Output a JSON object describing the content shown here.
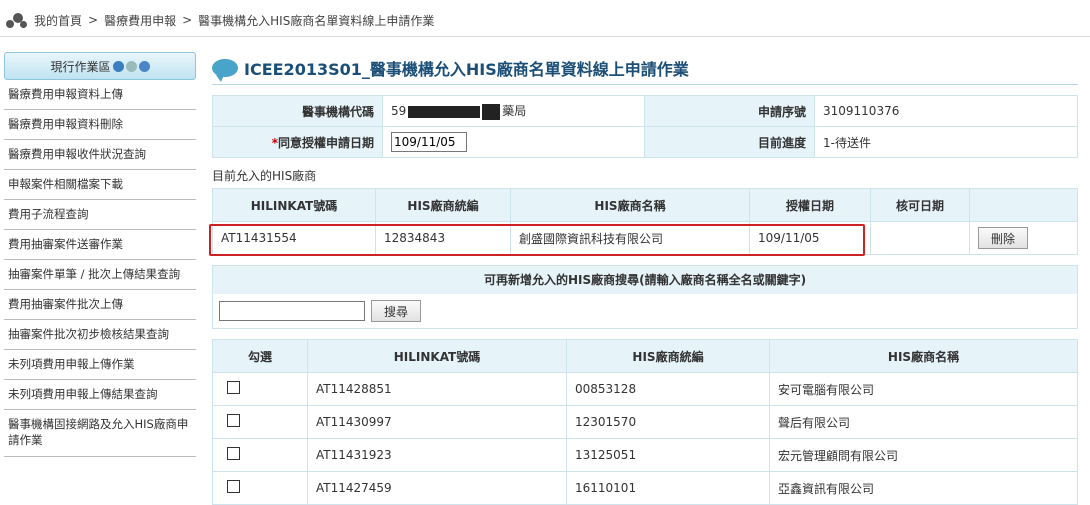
{
  "breadcrumb": {
    "home": "我的首頁",
    "sep": ">",
    "level1": "醫療費用申報",
    "level2": "醫事機構允入HIS廠商名單資料線上申請作業"
  },
  "sidebar": {
    "header": "現行作業區",
    "items": [
      "醫療費用申報資料上傳",
      "醫療費用申報資料刪除",
      "醫療費用申報收件狀況查詢",
      "申報案件相關檔案下載",
      "費用子流程查詢",
      "費用抽審案件送審作業",
      "抽審案件單筆 / 批次上傳結果查詢",
      "費用抽審案件批次上傳",
      "抽審案件批次初步檢核結果查詢",
      "未列項費用申報上傳作業",
      "未列項費用申報上傳結果查詢",
      "醫事機構固接網路及允入HIS廠商申請作業"
    ]
  },
  "page_title": "ICEE2013S01_醫事機構允入HIS廠商名單資料線上申請作業",
  "info": {
    "org_code_label": "醫事機構代碼",
    "org_code_prefix": "59",
    "org_code_suffix": "藥局",
    "serial_label": "申請序號",
    "serial_value": "3109110376",
    "date_label": "同意授權申請日期",
    "date_star": "*",
    "date_value": "109/11/05",
    "progress_label": "目前進度",
    "progress_value": "1-待送件"
  },
  "current_section": "目前允入的HIS廠商",
  "current_table": {
    "headers": [
      "HILINKAT號碼",
      "HIS廠商統編",
      "HIS廠商名稱",
      "授權日期",
      "核可日期",
      ""
    ],
    "row": {
      "hilinkat": "AT11431554",
      "tax_id": "12834843",
      "name": "創盛國際資訊科技有限公司",
      "auth_date": "109/11/05",
      "approve_date": "",
      "delete_label": "刪除"
    }
  },
  "search": {
    "header": "可再新增允入的HIS廠商搜尋(請輸入廠商名稱全名或關鍵字)",
    "input_value": "",
    "button_label": "搜尋"
  },
  "results_table": {
    "headers": [
      "勾選",
      "HILINKAT號碼",
      "HIS廠商統編",
      "HIS廠商名稱"
    ],
    "rows": [
      {
        "hilinkat": "AT11428851",
        "tax_id": "00853128",
        "name": "安可電腦有限公司"
      },
      {
        "hilinkat": "AT11430997",
        "tax_id": "12301570",
        "name": "聲后有限公司"
      },
      {
        "hilinkat": "AT11431923",
        "tax_id": "13125051",
        "name": "宏元管理顧問有限公司"
      },
      {
        "hilinkat": "AT11427459",
        "tax_id": "16110101",
        "name": "亞鑫資訊有限公司"
      }
    ]
  }
}
